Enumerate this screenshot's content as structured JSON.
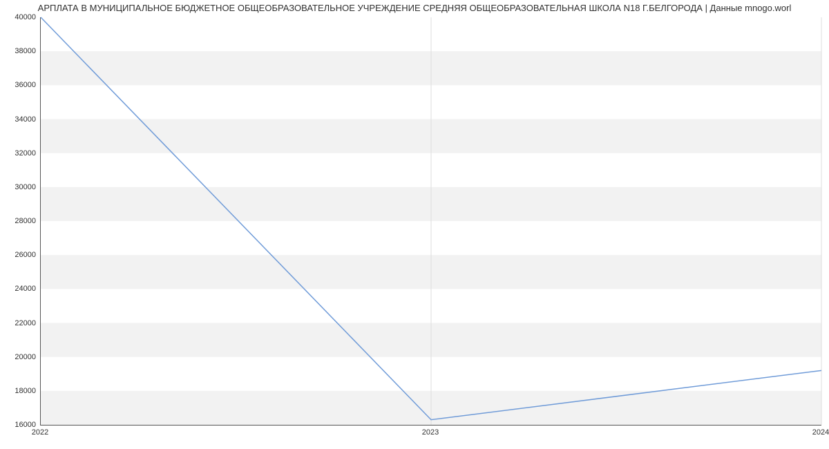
{
  "chart_data": {
    "type": "line",
    "title": "АРПЛАТА В МУНИЦИПАЛЬНОЕ БЮДЖЕТНОЕ ОБЩЕОБРАЗОВАТЕЛЬНОЕ УЧРЕЖДЕНИЕ СРЕДНЯЯ ОБЩЕОБРАЗОВАТЕЛЬНАЯ ШКОЛА N18 Г.БЕЛГОРОДА | Данные mnogo.worl",
    "x": [
      2022,
      2023,
      2024
    ],
    "values": [
      40000,
      16300,
      19200
    ],
    "xlabel": "",
    "ylabel": "",
    "xlim": [
      2022,
      2024
    ],
    "ylim": [
      16000,
      40000
    ],
    "y_ticks": [
      16000,
      18000,
      20000,
      22000,
      24000,
      26000,
      28000,
      30000,
      32000,
      34000,
      36000,
      38000,
      40000
    ],
    "x_ticks": [
      2022,
      2023,
      2024
    ]
  }
}
